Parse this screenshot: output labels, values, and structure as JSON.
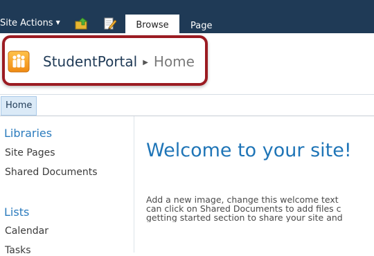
{
  "ribbon": {
    "site_actions_label": "Site Actions",
    "tabs": [
      {
        "label": "Browse",
        "selected": true
      },
      {
        "label": "Page",
        "selected": false
      }
    ]
  },
  "title_area": {
    "site_name": "StudentPortal",
    "page_name": "Home"
  },
  "top_nav": {
    "items": [
      {
        "label": "Home",
        "selected": true
      }
    ]
  },
  "quick_launch": {
    "sections": [
      {
        "heading": "Libraries",
        "items": [
          "Site Pages",
          "Shared Documents"
        ]
      },
      {
        "heading": "Lists",
        "items": [
          "Calendar",
          "Tasks"
        ]
      }
    ]
  },
  "main": {
    "title": "Welcome to your site!",
    "body_lines": [
      "Add a new image, change this welcome text",
      "can click on Shared Documents to add files c",
      "getting started section to share your site and"
    ]
  },
  "colors": {
    "ribbon_bg": "#1f3a56",
    "highlight_border": "#9b1b22",
    "link_blue": "#2b7bbd",
    "title_blue": "#1f75b7"
  },
  "icons": [
    "caret-down-icon",
    "navigate-up-icon",
    "edit-page-icon",
    "site-logo-icon",
    "breadcrumb-arrow-icon"
  ]
}
